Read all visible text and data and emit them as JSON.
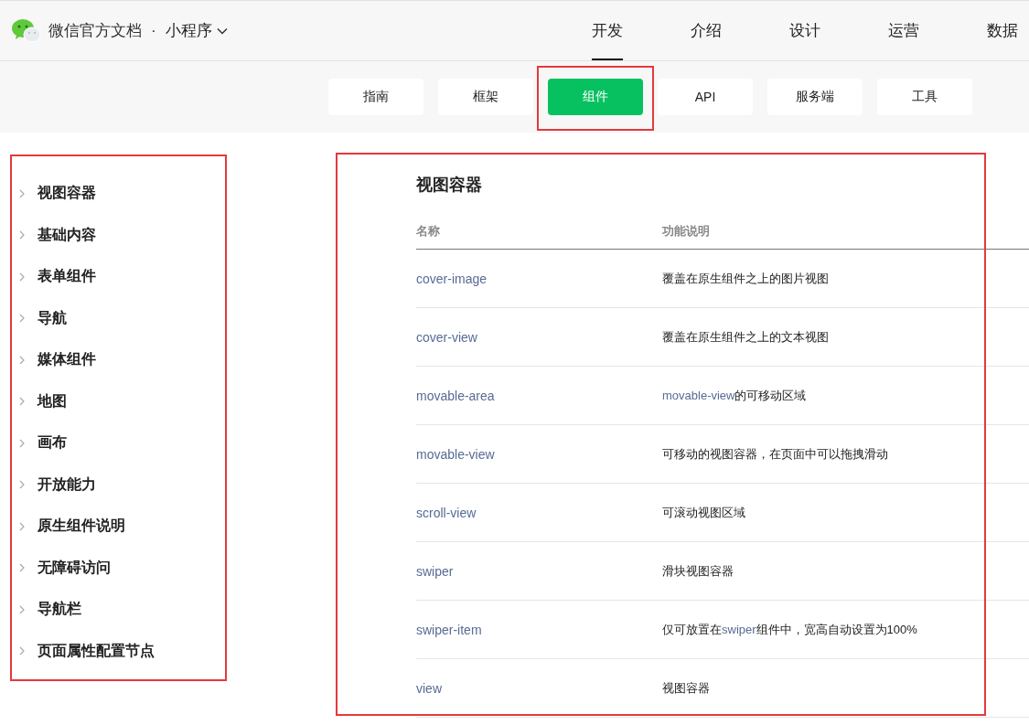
{
  "header": {
    "site_title": "微信官方文档",
    "separator": "·",
    "product": "小程序",
    "nav": [
      {
        "label": "开发",
        "selected": true
      },
      {
        "label": "介绍",
        "selected": false
      },
      {
        "label": "设计",
        "selected": false
      },
      {
        "label": "运营",
        "selected": false
      },
      {
        "label": "数据",
        "selected": false
      }
    ]
  },
  "subnav": {
    "tabs": [
      {
        "label": "指南",
        "selected": false,
        "highlighted": false
      },
      {
        "label": "框架",
        "selected": false,
        "highlighted": false
      },
      {
        "label": "组件",
        "selected": true,
        "highlighted": true
      },
      {
        "label": "API",
        "selected": false,
        "highlighted": false
      },
      {
        "label": "服务端",
        "selected": false,
        "highlighted": false
      },
      {
        "label": "工具",
        "selected": false,
        "highlighted": false
      }
    ]
  },
  "sidebar": {
    "highlighted": true,
    "items": [
      {
        "label": "视图容器"
      },
      {
        "label": "基础内容"
      },
      {
        "label": "表单组件"
      },
      {
        "label": "导航"
      },
      {
        "label": "媒体组件"
      },
      {
        "label": "地图"
      },
      {
        "label": "画布"
      },
      {
        "label": "开放能力"
      },
      {
        "label": "原生组件说明"
      },
      {
        "label": "无障碍访问"
      },
      {
        "label": "导航栏"
      },
      {
        "label": "页面属性配置节点"
      }
    ]
  },
  "content": {
    "highlighted": true,
    "title": "视图容器",
    "table": {
      "columns": [
        "名称",
        "功能说明"
      ],
      "rows": [
        {
          "name": "cover-image",
          "description": [
            {
              "kind": "text",
              "text": "覆盖在原生组件之上的图片视图"
            }
          ]
        },
        {
          "name": "cover-view",
          "description": [
            {
              "kind": "text",
              "text": "覆盖在原生组件之上的文本视图"
            }
          ]
        },
        {
          "name": "movable-area",
          "description": [
            {
              "kind": "link",
              "text": "movable-view"
            },
            {
              "kind": "text",
              "text": "的可移动区域"
            }
          ]
        },
        {
          "name": "movable-view",
          "description": [
            {
              "kind": "text",
              "text": "可移动的视图容器，在页面中可以拖拽滑动"
            }
          ]
        },
        {
          "name": "scroll-view",
          "description": [
            {
              "kind": "text",
              "text": "可滚动视图区域"
            }
          ]
        },
        {
          "name": "swiper",
          "description": [
            {
              "kind": "text",
              "text": "滑块视图容器"
            }
          ]
        },
        {
          "name": "swiper-item",
          "description": [
            {
              "kind": "text",
              "text": "仅可放置在"
            },
            {
              "kind": "link",
              "text": "swiper"
            },
            {
              "kind": "text",
              "text": "组件中，宽高自动设置为100%"
            }
          ]
        },
        {
          "name": "view",
          "description": [
            {
              "kind": "text",
              "text": "视图容器"
            }
          ]
        }
      ]
    }
  }
}
